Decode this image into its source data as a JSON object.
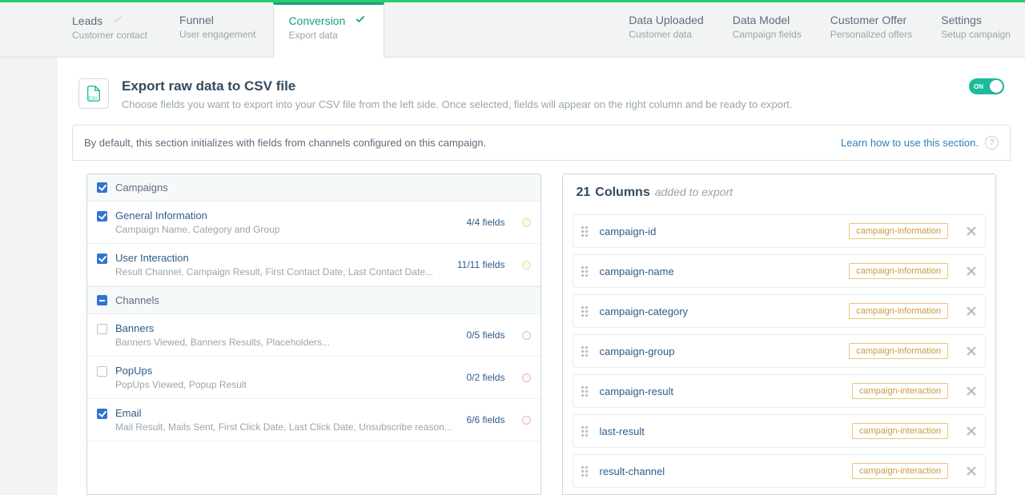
{
  "tabs": {
    "left": [
      {
        "title": "Leads",
        "subtitle": "Customer contact",
        "check": true,
        "active": false
      },
      {
        "title": "Funnel",
        "subtitle": "User engagement",
        "check": false,
        "active": false
      },
      {
        "title": "Conversion",
        "subtitle": "Export data",
        "check": true,
        "active": true
      }
    ],
    "right": [
      {
        "title": "Data Uploaded",
        "subtitle": "Customer data"
      },
      {
        "title": "Data Model",
        "subtitle": "Campaign fields"
      },
      {
        "title": "Customer Offer",
        "subtitle": "Personalized offers"
      },
      {
        "title": "Settings",
        "subtitle": "Setup campaign"
      }
    ]
  },
  "header": {
    "title": "Export raw data to CSV file",
    "subtitle": "Choose fields you want to export into your CSV file from the left side. Once selected, fields will appear on the right column and be ready to export.",
    "toggle": "ON"
  },
  "notice": {
    "text": "By default, this section initializes with fields from channels configured on this campaign.",
    "link": "Learn how to use this section."
  },
  "groups": [
    {
      "kind": "head",
      "label": "Campaigns",
      "state": "on"
    },
    {
      "kind": "row",
      "name": "General Information",
      "desc": "Campaign Name, Category and Group",
      "count": "4/4 fields",
      "state": "on",
      "dot": "yellow"
    },
    {
      "kind": "row",
      "name": "User Interaction",
      "desc": "Result Channel, Campaign Result, First Contact Date, Last Contact Date...",
      "count": "11/11 fields",
      "state": "on",
      "dot": "yellow"
    },
    {
      "kind": "head",
      "label": "Channels",
      "state": "minus"
    },
    {
      "kind": "row",
      "name": "Banners",
      "desc": "Banners Viewed, Banners Results, Placeholders...",
      "count": "0/5 fields",
      "state": "off",
      "dot": "pink"
    },
    {
      "kind": "row",
      "name": "PopUps",
      "desc": "PopUps Viewed, Popup Result",
      "count": "0/2 fields",
      "state": "off",
      "dot": "pink"
    },
    {
      "kind": "row",
      "name": "Email",
      "desc": "Mail Result, Mails Sent, First Click Date, Last Click Date, Unsubscribe reason...",
      "count": "6/6 fields",
      "state": "on",
      "dot": "pink"
    }
  ],
  "export": {
    "count": "21",
    "label": "Columns",
    "suffix": "added to export",
    "columns": [
      {
        "name": "campaign-id",
        "tag": "campaign-information"
      },
      {
        "name": "campaign-name",
        "tag": "campaign-information"
      },
      {
        "name": "campaign-category",
        "tag": "campaign-information"
      },
      {
        "name": "campaign-group",
        "tag": "campaign-information"
      },
      {
        "name": "campaign-result",
        "tag": "campaign-interaction"
      },
      {
        "name": "last-result",
        "tag": "campaign-interaction"
      },
      {
        "name": "result-channel",
        "tag": "campaign-interaction"
      }
    ]
  }
}
